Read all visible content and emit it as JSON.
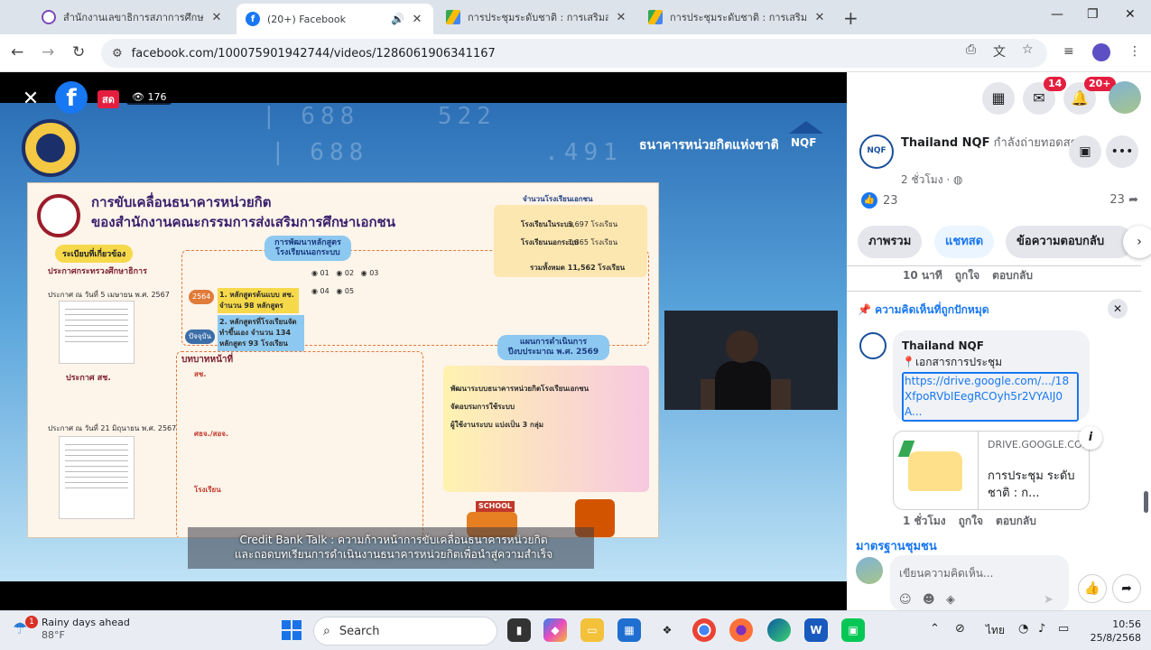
{
  "browser": {
    "tabs": [
      {
        "title": "สำนักงานเลขาธิการสภาการศึกษา :: ส",
        "favicon": "edu-icon",
        "active": false
      },
      {
        "title": "(20+) Facebook",
        "favicon": "facebook-icon",
        "active": true
      },
      {
        "title": "การประชุมระดับชาติ : การเสริมสร้างห",
        "favicon": "google-drive-icon",
        "active": false
      },
      {
        "title": "การประชุมระดับชาติ : การเสริมสร้างห",
        "favicon": "google-drive-icon",
        "active": false
      }
    ],
    "new_tab": "+",
    "url": "facebook.com/100075901942744/videos/1286061906341167"
  },
  "video": {
    "live_label": "สด",
    "viewer_count": "176",
    "brand_text": "ธนาคารหน่วยกิตแห่งชาติ",
    "brand_logo": "NQF",
    "slide": {
      "title_line1": "การขับเคลื่อนธนาคารหน่วยกิต",
      "title_line2": "ของสำนักงานคณะกรรมการส่งเสริมการศึกษาเอกชน",
      "regulations_label": "ระเบียบที่เกี่ยวข้อง",
      "announcement_1_title": "ประกาศกระทรวงศึกษาธิการ",
      "announcement_1_date": "ประกาศ ณ วันที่ 5 เมษายน พ.ศ. 2567",
      "announcement_2_title": "ประกาศ สช.",
      "announcement_2_date": "ประกาศ ณ วันที่ 21 มิถุนายน พ.ศ. 2567",
      "curriculum_label": "การพัฒนาหลักสูตร โรงเรียนนอกระบบ",
      "course_1": "1. หลักสูตรต้นแบบ สช. จำนวน 98 หลักสูตร",
      "course_2": "2. หลักสูตรที่โรงเรียนจัดทำขึ้นเอง จำนวน 134 หลักสูตร 93 โรงเรียน",
      "step_2025": "2564",
      "step_now": "ปัจจุบัน",
      "school_count_label": "จำนวนโรงเรียนเอกชน",
      "school_count_1_label": "โรงเรียนในระบบ",
      "school_count_1": "3,697 โรงเรียน",
      "school_count_2_label": "โรงเรียนนอกระบบ",
      "school_count_2": "7,865 โรงเรียน",
      "school_total": "รวมทั้งหมด 11,562 โรงเรียน",
      "roles_label": "บทบาทหน้าที่",
      "role_1": "สช.",
      "role_2": "ศธจ./สอจ.",
      "role_3": "โรงเรียน",
      "plan_label": "แผนการดำเนินการ ปีงบประมาณ พ.ศ. 2569",
      "plan_1": "พัฒนาระบบธนาคารหน่วยกิตโรงเรียนเอกชน",
      "plan_2": "จัดอบรมการใช้ระบบ",
      "plan_3": "ผู้ใช้งานระบบ แบ่งเป็น 3 กลุ่ม",
      "school_sign": "SCHOOL"
    },
    "subtitle_line1": "Credit Bank Talk : ความก้าวหน้าการขับเคลื่อนธนาคารหน่วยกิต",
    "subtitle_line2": "และถอดบทเรียนการดำเนินงานธนาคารหน่วยกิตเพื่อนำสู่ความสำเร็จ"
  },
  "facebook": {
    "messenger_badge": "14",
    "notifications_badge": "20+",
    "page_name": "Thailand NQF",
    "page_status": " กำลังถ่ายทอดสด",
    "post_time": "2 ชั่วโมง · ",
    "reaction_count": "23",
    "share_count": "23",
    "tabs": [
      "ภาพรวม",
      "แชทสด",
      "ข้อความตอบกลับ"
    ],
    "prev_comment_time": "10 นาที",
    "like_label": "ถูกใจ",
    "reply_label": "ตอบกลับ",
    "pinned_label": "ความคิดเห็นที่ถูกปักหมุด",
    "pinned_comment": {
      "author": "Thailand NQF",
      "text": "📍เอกสารการประชุม",
      "link": "https://drive.google.com/.../18XfpoRVbIEegRCOyh5r2VYAIJ0A...",
      "preview_domain": "DRIVE.GOOGLE.COM",
      "preview_title": "การประชุม ระดับชาติ : ก...",
      "time": "1 ชั่วโมง"
    },
    "next_commenter": "มาตรฐานชุมชน",
    "compose_placeholder": "เขียนความคิดเห็น..."
  },
  "taskbar": {
    "weather_title": "Rainy days ahead",
    "weather_temp": "88°F",
    "weather_badge": "1",
    "search_label": "Search",
    "language": "ไทย",
    "time": "10:56",
    "date": "25/8/2568"
  }
}
